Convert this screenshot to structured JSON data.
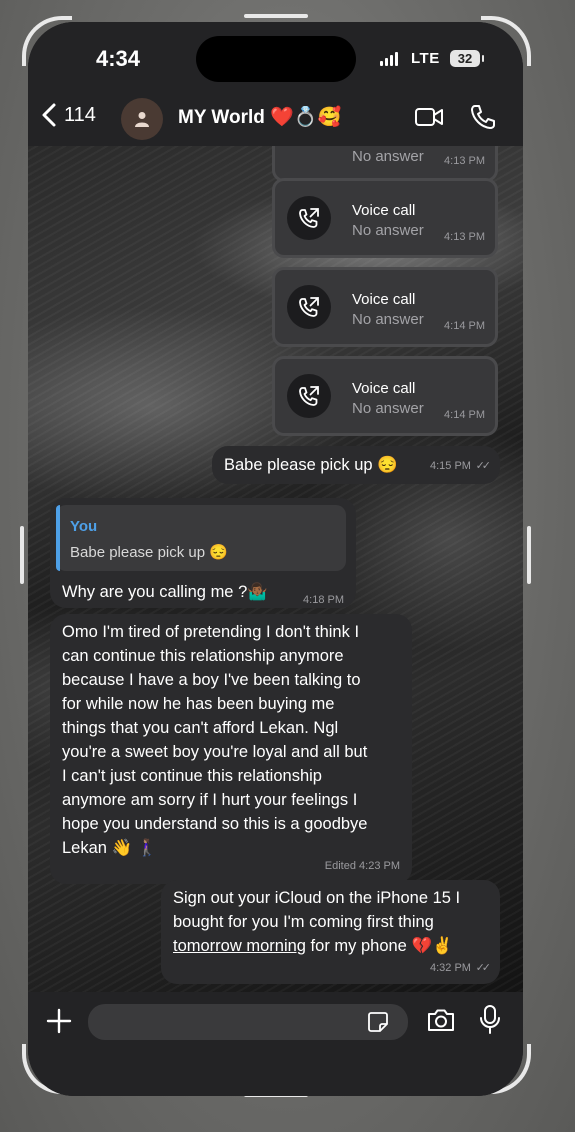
{
  "status_bar": {
    "time": "4:34",
    "network": "LTE",
    "battery": "32"
  },
  "header": {
    "back_count": "114",
    "chat_title": "MY World ❤️💍🥰"
  },
  "messages": {
    "partial_call": {
      "status": "No answer",
      "time": "4:13 PM"
    },
    "calls": [
      {
        "title": "Voice call",
        "status": "No answer",
        "time": "4:13 PM"
      },
      {
        "title": "Voice call",
        "status": "No answer",
        "time": "4:14 PM"
      },
      {
        "title": "Voice call",
        "status": "No answer",
        "time": "4:14 PM"
      }
    ],
    "out1": {
      "text": "Babe please pick up 😔",
      "time": "4:15 PM"
    },
    "in1": {
      "reply_name": "You",
      "reply_text": "Babe please pick up 😔",
      "text": "Why are you calling me ?🤷🏾‍♂️",
      "time": "4:18 PM"
    },
    "in2": {
      "lines": [
        "Omo I'm tired of pretending I don't think I",
        "can continue this relationship anymore",
        "because I have a  boy I've been talking to",
        "for while now he has been buying me",
        "things that you can't afford Lekan. Ngl",
        "you're a sweet boy you're loyal and all but",
        "I can't just continue this relationship",
        "anymore am sorry if I hurt your feelings I",
        "hope you understand so this is a goodbye",
        "Lekan 👋 🚶🏽‍♀️"
      ],
      "time": "Edited 4:23 PM"
    },
    "out2": {
      "line1": "Sign out your iCloud on the iPhone 15 I",
      "line2": "bought for you I'm coming first thing",
      "line3_underlined": "tomorrow morning",
      "line3_rest": " for my phone 💔✌️",
      "time": "4:32 PM"
    }
  },
  "composer": {
    "placeholder": ""
  },
  "colors": {
    "accent": "#4ea0e8",
    "bubble": "#2b2b2d",
    "call_bubble": "#38383a"
  }
}
